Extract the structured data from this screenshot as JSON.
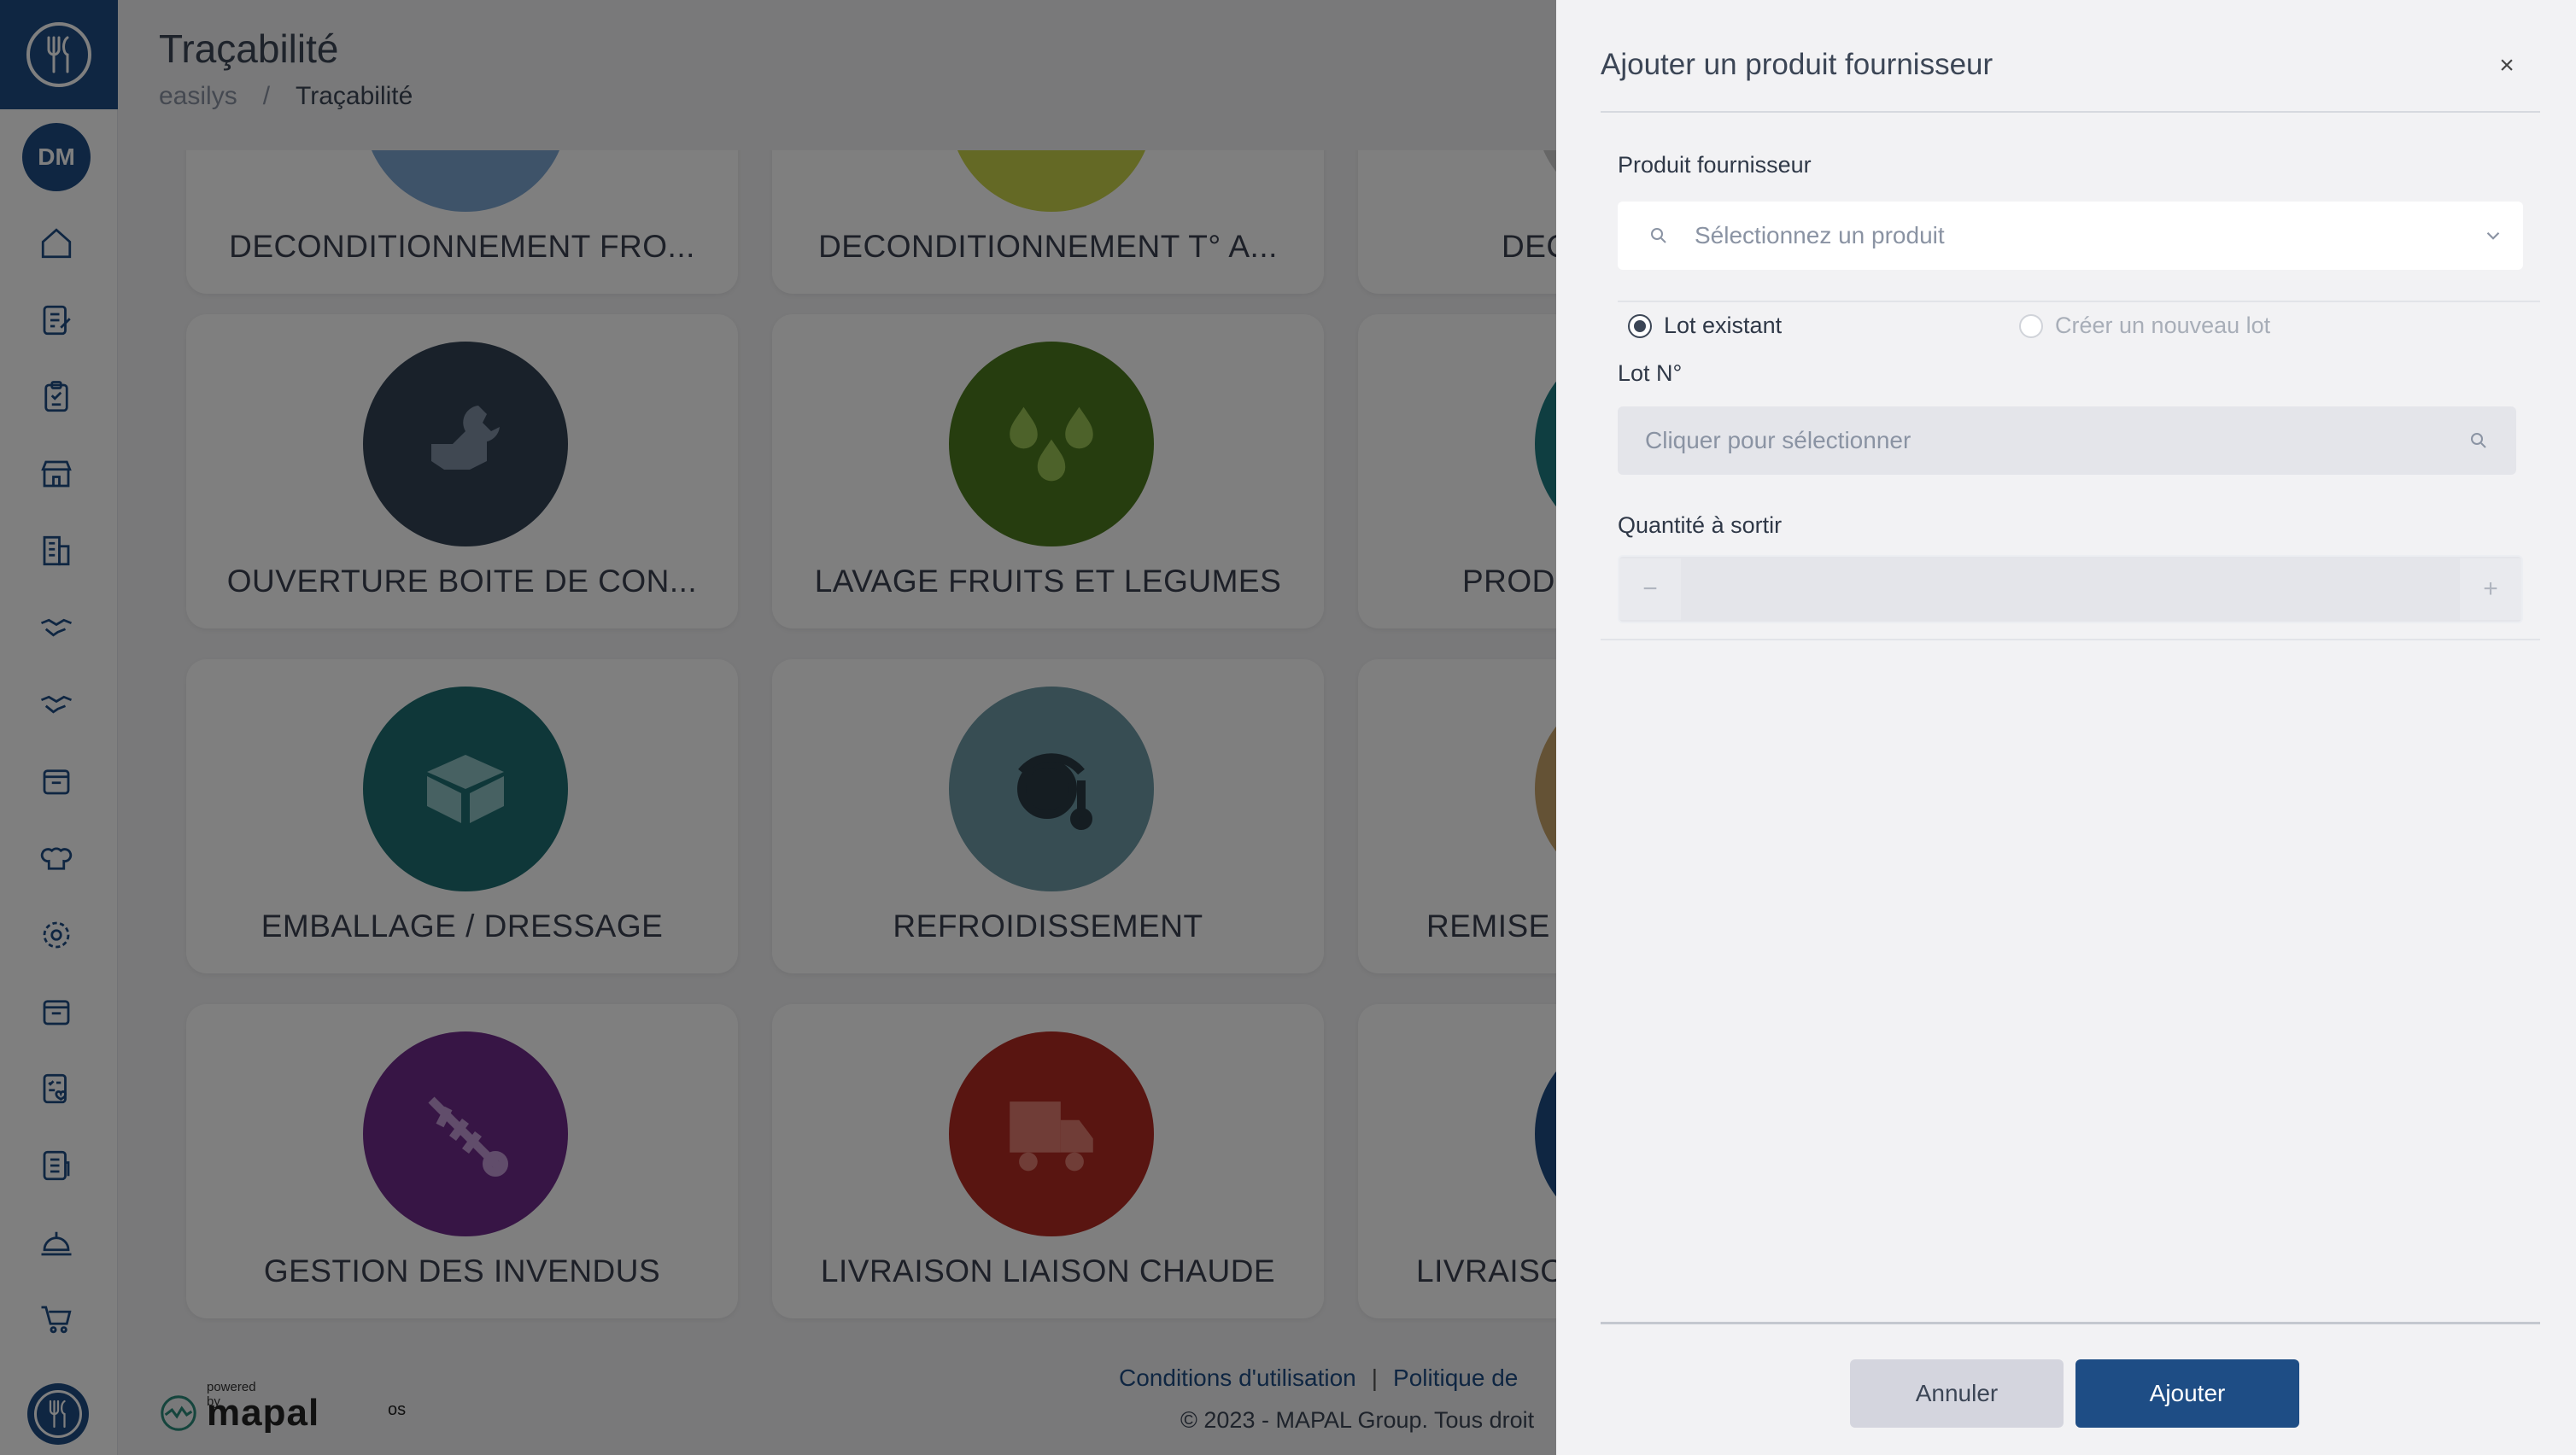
{
  "sidebar": {
    "avatar_initials": "DM",
    "brand_color": "#1e4d85",
    "nav_icons": [
      "home-icon",
      "edit-document-icon",
      "clipboard-check-icon",
      "store-icon",
      "building-icon",
      "handshake-icon",
      "handshake-alt-icon",
      "box-icon",
      "chef-hat-icon",
      "gear-icon",
      "basket-icon",
      "checklist-heart-icon",
      "report-icon",
      "service-bell-icon",
      "cart-icon"
    ]
  },
  "header": {
    "title": "Traçabilité",
    "breadcrumb": {
      "root": "easilys",
      "separator": "/",
      "current": "Traçabilité"
    }
  },
  "cards": [
    {
      "label": "DECONDITIONNEMENT FRO...",
      "color": "#7da6d2",
      "icon": "partial-circle-icon"
    },
    {
      "label": "DECONDITIONNEMENT T° A...",
      "color": "#c9d24a",
      "icon": "partial-circle-icon"
    },
    {
      "label": "DEC",
      "color": "#cccccc",
      "icon": "partial-circle-icon"
    },
    {
      "label": "OUVERTURE BOITE DE CON...",
      "color": "#324255",
      "icon": "wrench-hand-icon"
    },
    {
      "label": "LAVAGE FRUITS ET LEGUMES",
      "color": "#4d7a1e",
      "icon": "water-drops-icon"
    },
    {
      "label": "PROD",
      "color": "#1e7c82",
      "icon": "circle-icon"
    },
    {
      "label": "EMBALLAGE / DRESSAGE",
      "color": "#1f6f72",
      "icon": "box-icon"
    },
    {
      "label": "REFROIDISSEMENT",
      "color": "#6e9aa6",
      "icon": "cooling-thermometer-icon"
    },
    {
      "label": "REMISE",
      "color": "#c9a46a",
      "icon": "circle-icon"
    },
    {
      "label": "GESTION DES INVENDUS",
      "color": "#6f2b8b",
      "icon": "fish-bone-icon"
    },
    {
      "label": "LIVRAISON LIAISON CHAUDE",
      "color": "#b22a22",
      "icon": "truck-icon"
    },
    {
      "label": "LIVRAISO",
      "color": "#1e4d85",
      "icon": "circle-icon"
    }
  ],
  "footer": {
    "terms": "Conditions d'utilisation",
    "separator": "|",
    "policy": "Politique de",
    "copyright": "© 2023 - MAPAL Group. Tous droit",
    "powered_by": "powered by",
    "brand": "mapal",
    "brand_suffix": "os"
  },
  "drawer": {
    "title": "Ajouter un produit fournisseur",
    "close": "×",
    "product_label": "Produit fournisseur",
    "product_placeholder": "Sélectionnez un produit",
    "radio_existing": "Lot existant",
    "radio_new": "Créer un nouveau lot",
    "lot_label": "Lot N°",
    "lot_placeholder": "Cliquer pour sélectionner",
    "qty_label": "Quantité à sortir",
    "qty_minus": "−",
    "qty_plus": "+",
    "cancel": "Annuler",
    "add": "Ajouter"
  }
}
